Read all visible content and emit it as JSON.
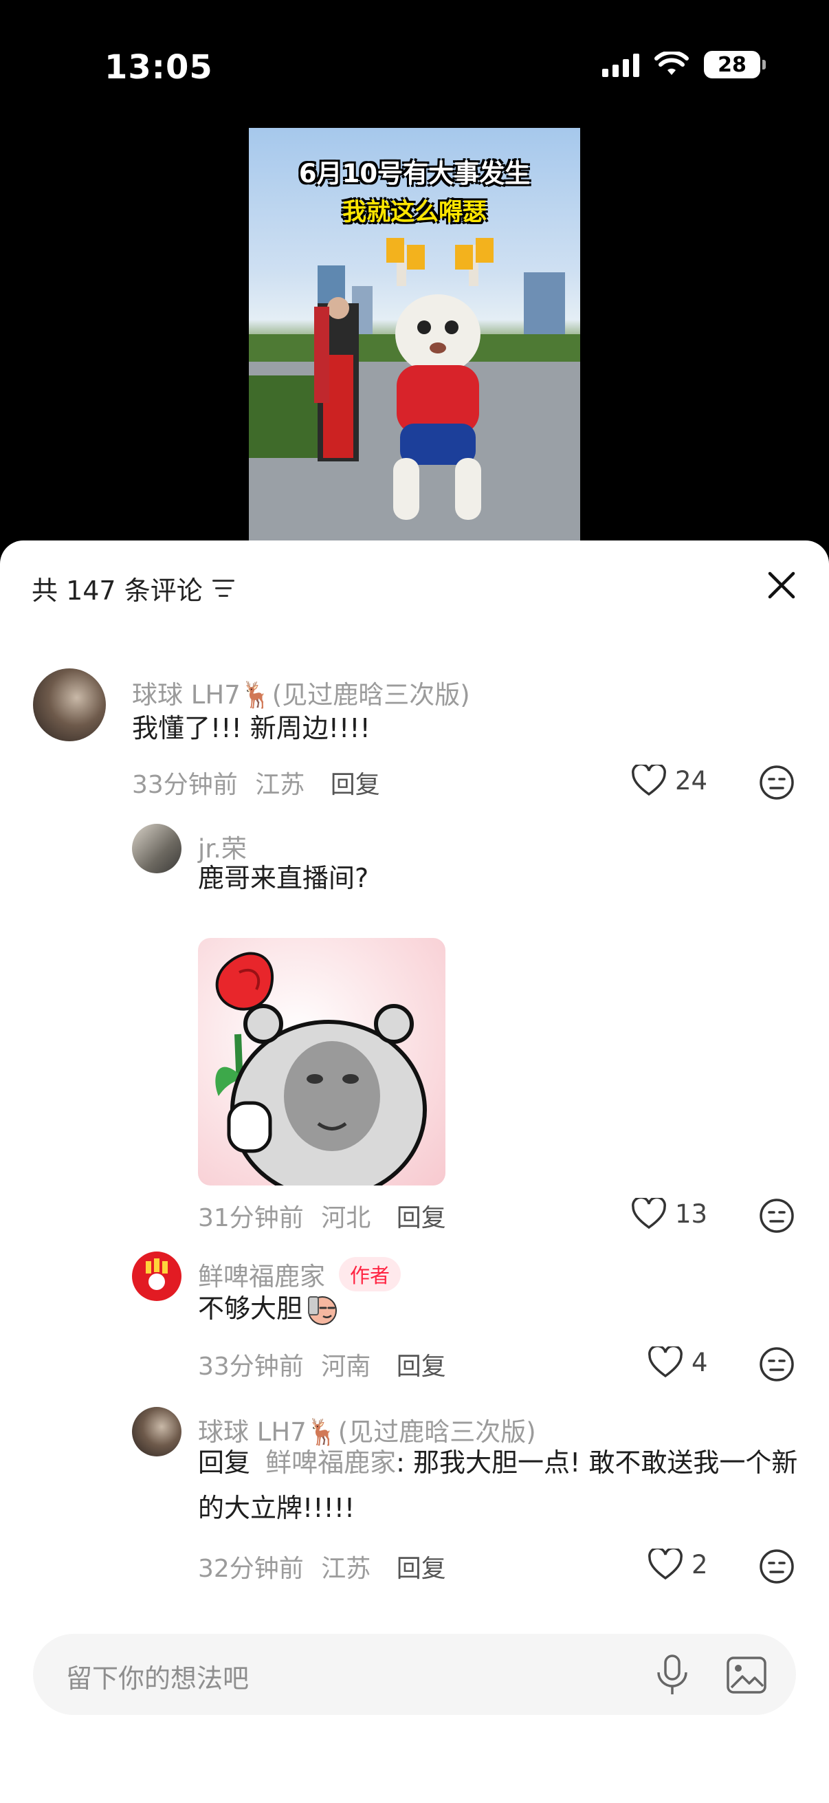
{
  "status_bar": {
    "time": "13:05",
    "battery": "28"
  },
  "video": {
    "caption_line1": "6月10号有大事发生",
    "caption_line2": "我就这么嘚瑟"
  },
  "comments_panel": {
    "title": "共 147 条评论"
  },
  "comments": [
    {
      "author": "球球 LH7🦌(见过鹿晗三次版)",
      "text": "我懂了!!! 新周边!!!!",
      "time": "33分钟前",
      "location": "江苏",
      "reply_label": "回复",
      "likes": "24"
    },
    {
      "author": "jr.荣",
      "text": "鹿哥来直播间?",
      "time": "31分钟前",
      "location": "河北",
      "reply_label": "回复",
      "likes": "13"
    },
    {
      "author": "鲜啤福鹿家",
      "badge": "作者",
      "text": "不够大胆",
      "time": "33分钟前",
      "location": "河南",
      "reply_label": "回复",
      "likes": "4"
    },
    {
      "author": "球球 LH7🦌(见过鹿晗三次版)",
      "reply_prefix": "回复",
      "mention": "鲜啤福鹿家",
      "text": ": 那我大胆一点! 敢不敢送我一个新的大立牌!!!!!",
      "time": "32分钟前",
      "location": "江苏",
      "reply_label": "回复",
      "likes": "2"
    }
  ],
  "input": {
    "placeholder": "留下你的想法吧"
  },
  "colors": {
    "accent": "#ff2442",
    "meta_gray": "#9b9b9b",
    "panel_bg": "#ffffff"
  }
}
